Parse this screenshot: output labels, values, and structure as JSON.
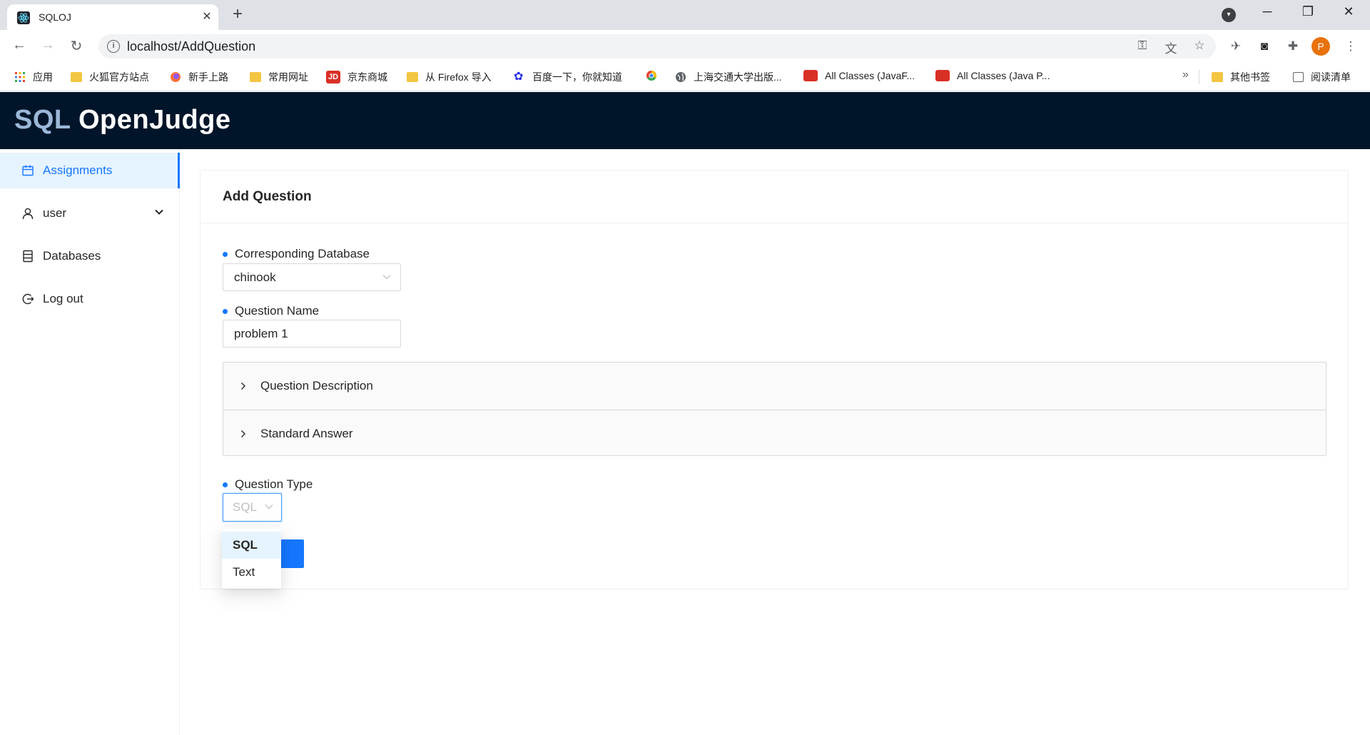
{
  "browser": {
    "tab_title": "SQLOJ",
    "tab_close": "✕",
    "new_tab": "+",
    "url": "localhost/AddQuestion",
    "window_controls": [
      "─",
      "❐",
      "✕"
    ],
    "avatar_letter": "P",
    "bookmarks": [
      {
        "label": "应用",
        "icon": "apps-grid-icon"
      },
      {
        "label": "火狐官方站点",
        "icon": "folder-icon"
      },
      {
        "label": "新手上路",
        "icon": "firefox-icon"
      },
      {
        "label": "常用网址",
        "icon": "folder-icon"
      },
      {
        "label": "京东商城",
        "icon": "jd-icon"
      },
      {
        "label": "从 Firefox 导入",
        "icon": "folder-icon"
      },
      {
        "label": "百度一下，你就知道",
        "icon": "baidu-icon"
      },
      {
        "label": "",
        "icon": "chrome-icon"
      },
      {
        "label": "上海交通大学出版...",
        "icon": "globe-icon"
      },
      {
        "label": "All Classes (JavaF...",
        "icon": "oracle-icon"
      },
      {
        "label": "All Classes (Java P...",
        "icon": "oracle-icon"
      }
    ],
    "bookmarks_more": "»",
    "other_bookmarks": "其他书签",
    "reading_list": "阅读清单"
  },
  "app": {
    "title_part1": "SQL",
    "title_part2": " OpenJudge",
    "colors": {
      "header_bg": "#001529",
      "accent": "#1677ff"
    }
  },
  "sidebar": {
    "items": [
      {
        "label": "Assignments",
        "icon": "calendar-icon",
        "active": true
      },
      {
        "label": "user",
        "icon": "user-icon",
        "active": false
      },
      {
        "label": "Databases",
        "icon": "database-icon",
        "active": false
      },
      {
        "label": "Log out",
        "icon": "logout-icon",
        "active": false
      }
    ]
  },
  "form": {
    "title": "Add Question",
    "database_label": "Corresponding Database",
    "database_value": "chinook",
    "name_label": "Question Name",
    "name_value": "problem 1",
    "description_panel": "Question Description",
    "answer_panel": "Standard Answer",
    "type_label": "Question Type",
    "type_value": "SQL",
    "type_options": [
      "SQL",
      "Text"
    ]
  }
}
